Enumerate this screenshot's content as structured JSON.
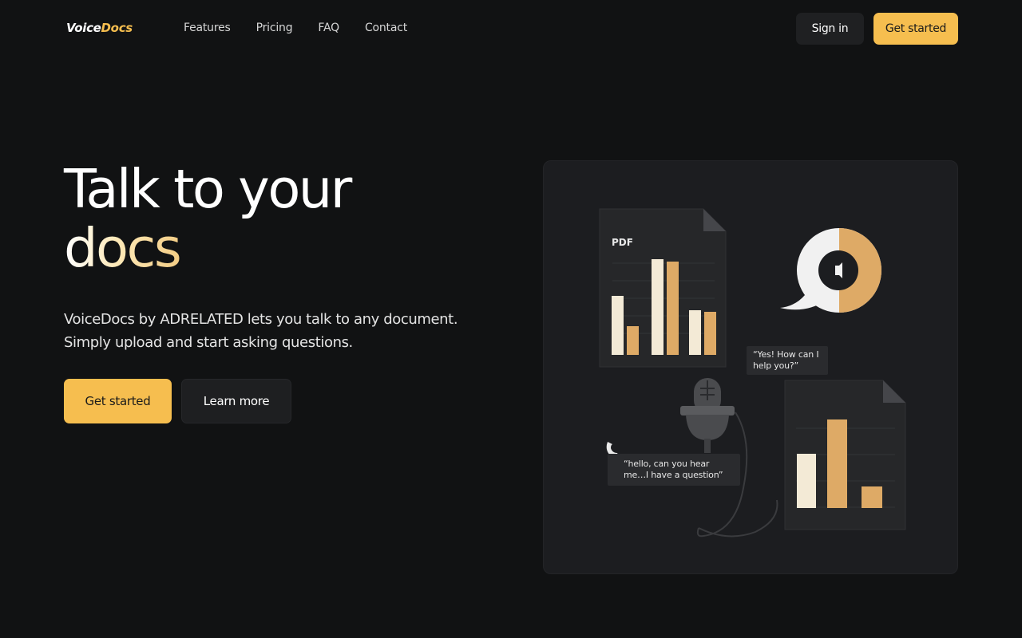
{
  "nav": {
    "logo_part1": "Voice",
    "logo_part2": "Docs",
    "links": [
      "Features",
      "Pricing",
      "FAQ",
      "Contact"
    ],
    "signin_label": "Sign in",
    "get_started_label": "Get started"
  },
  "hero": {
    "title_line1": "Talk to your",
    "title_line2": "docs",
    "subtitle_line1": "VoiceDocs by ADRELATED lets you talk to any document.",
    "subtitle_line2": "Simply upload and start asking questions.",
    "primary_cta": "Get started",
    "secondary_cta": "Learn more"
  },
  "illustration": {
    "pdf_label": "PDF",
    "ai_quote": "“Yes! How can I help you?”",
    "user_quote": "“hello, can you hear me…I have a question”"
  },
  "colors": {
    "background": "#111213",
    "accent": "#f6be4f",
    "panel": "#1c1d20",
    "bar_light": "#f3ead6",
    "bar_tan": "#deaa66"
  }
}
